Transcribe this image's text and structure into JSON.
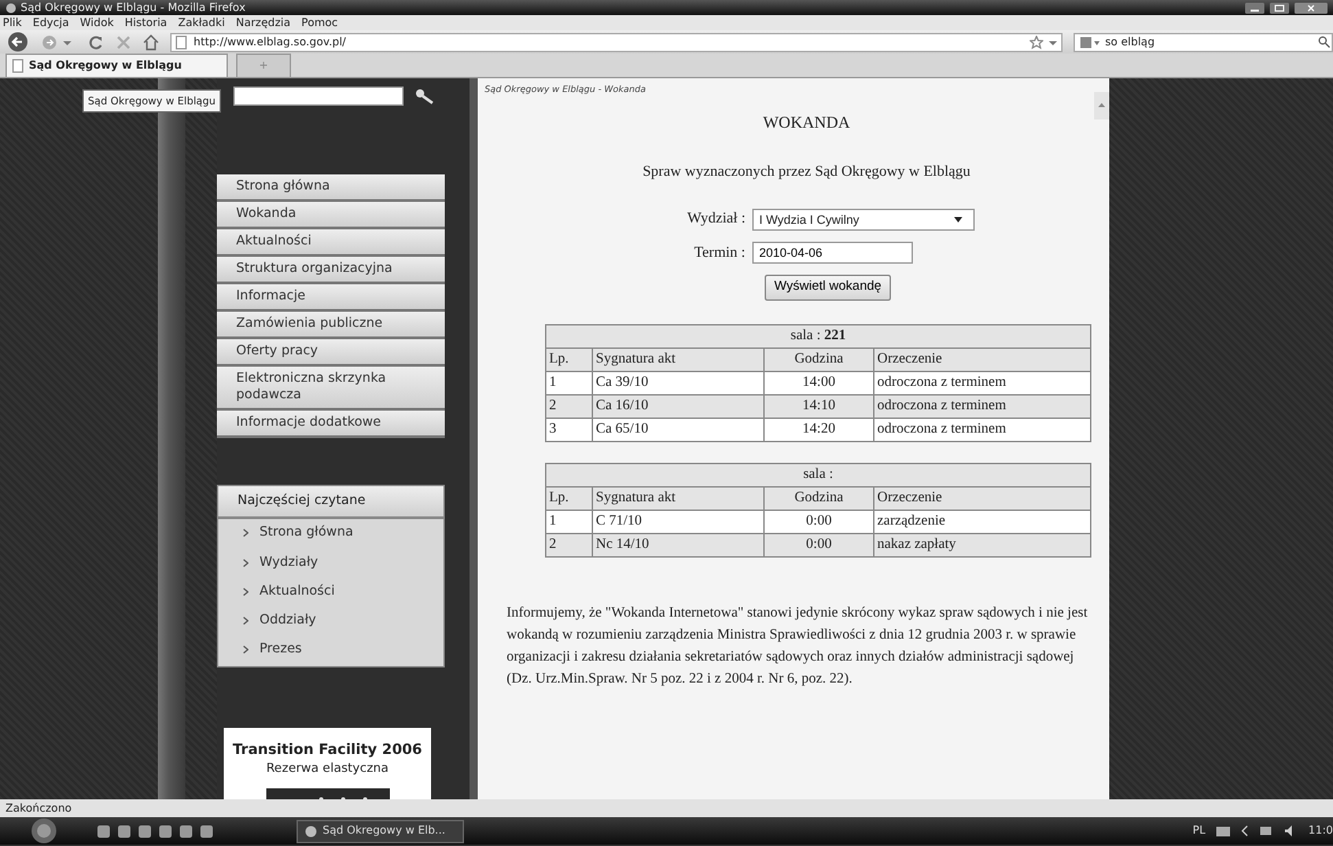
{
  "window": {
    "title": "Sąd Okręgowy w Elblągu - Mozilla Firefox"
  },
  "menu_bar": [
    "Plik",
    "Edycja",
    "Widok",
    "Historia",
    "Zakładki",
    "Narzędzia",
    "Pomoc"
  ],
  "toolbar": {
    "address": "http://www.elblag.so.gov.pl/",
    "search": "so elbląg"
  },
  "tabs": [
    {
      "label": "Sąd Okręgowy w Elblągu",
      "selected": true
    }
  ],
  "new_tab": "+",
  "tooltip": "Sąd Okręgowy w Elblągu",
  "sidebar": {
    "menu": [
      "Strona główna",
      "Wokanda",
      "Aktualności",
      "Struktura organizacyjna",
      "Informacje",
      "Zamówienia publiczne",
      "Oferty pracy",
      "Elektroniczna skrzynka podawcza",
      "Informacje dodatkowe"
    ],
    "most_read": {
      "title": "Najczęściej czytane",
      "items": [
        "Strona główna",
        "Wydziały",
        "Aktualności",
        "Oddziały",
        "Prezes"
      ]
    },
    "banner": {
      "title": "Transition Facility 2006",
      "subtitle": "Rezerwa elastyczna"
    }
  },
  "main": {
    "breadcrumb": "Sąd Okręgowy w Elblągu - Wokanda",
    "heading": "WOKANDA",
    "subtitle": "Spraw wyznaczonych przez Sąd Okręgowy w Elblągu",
    "fields": [
      {
        "kind": "select",
        "label": "Wydział :",
        "value": "I Wydzia I Cywilny"
      },
      {
        "kind": "text",
        "label": "Termin :",
        "value": "2010-04-06"
      }
    ],
    "button": "Wyświetl wokandę",
    "tables": [
      {
        "caption": "sala : **221**",
        "columns": [
          "Lp.",
          "Sygnatura akt",
          "Godzina",
          "Orzeczenie"
        ],
        "rows": [
          [
            "1",
            "Ca 39/10",
            "14:00",
            "odroczona z terminem"
          ],
          [
            "2",
            "Ca 16/10",
            "14:10",
            "odroczona z terminem"
          ],
          [
            "3",
            "Ca 65/10",
            "14:20",
            "odroczona z terminem"
          ]
        ]
      },
      {
        "caption": "sala :",
        "columns": [
          "Lp.",
          "Sygnatura akt",
          "Godzina",
          "Orzeczenie"
        ],
        "rows": [
          [
            "1",
            "C 71/10",
            "0:00",
            "zarządzenie"
          ],
          [
            "2",
            "Nc 14/10",
            "0:00",
            "nakaz zapłaty"
          ]
        ]
      }
    ],
    "notice": "Informujemy, że \"Wokanda Internetowa\" stanowi jedynie skrócony wykaz spraw sądowych i nie jest wokandą w rozumieniu zarządzenia Ministra Sprawiedliwości z dnia 12 grudnia 2003 r. w sprawie organizacji i zakresu działania sekretariatów sądowych oraz innych działów administracji sądowej (Dz. Urz.Min.Spraw. Nr 5 poz. 22 i z 2004 r. Nr 6, poz. 22)."
  },
  "status_bar": "Zakończono",
  "taskbar": {
    "task": "Sąd Okregowy w Elb...",
    "language": "PL",
    "clock": "11:0"
  }
}
